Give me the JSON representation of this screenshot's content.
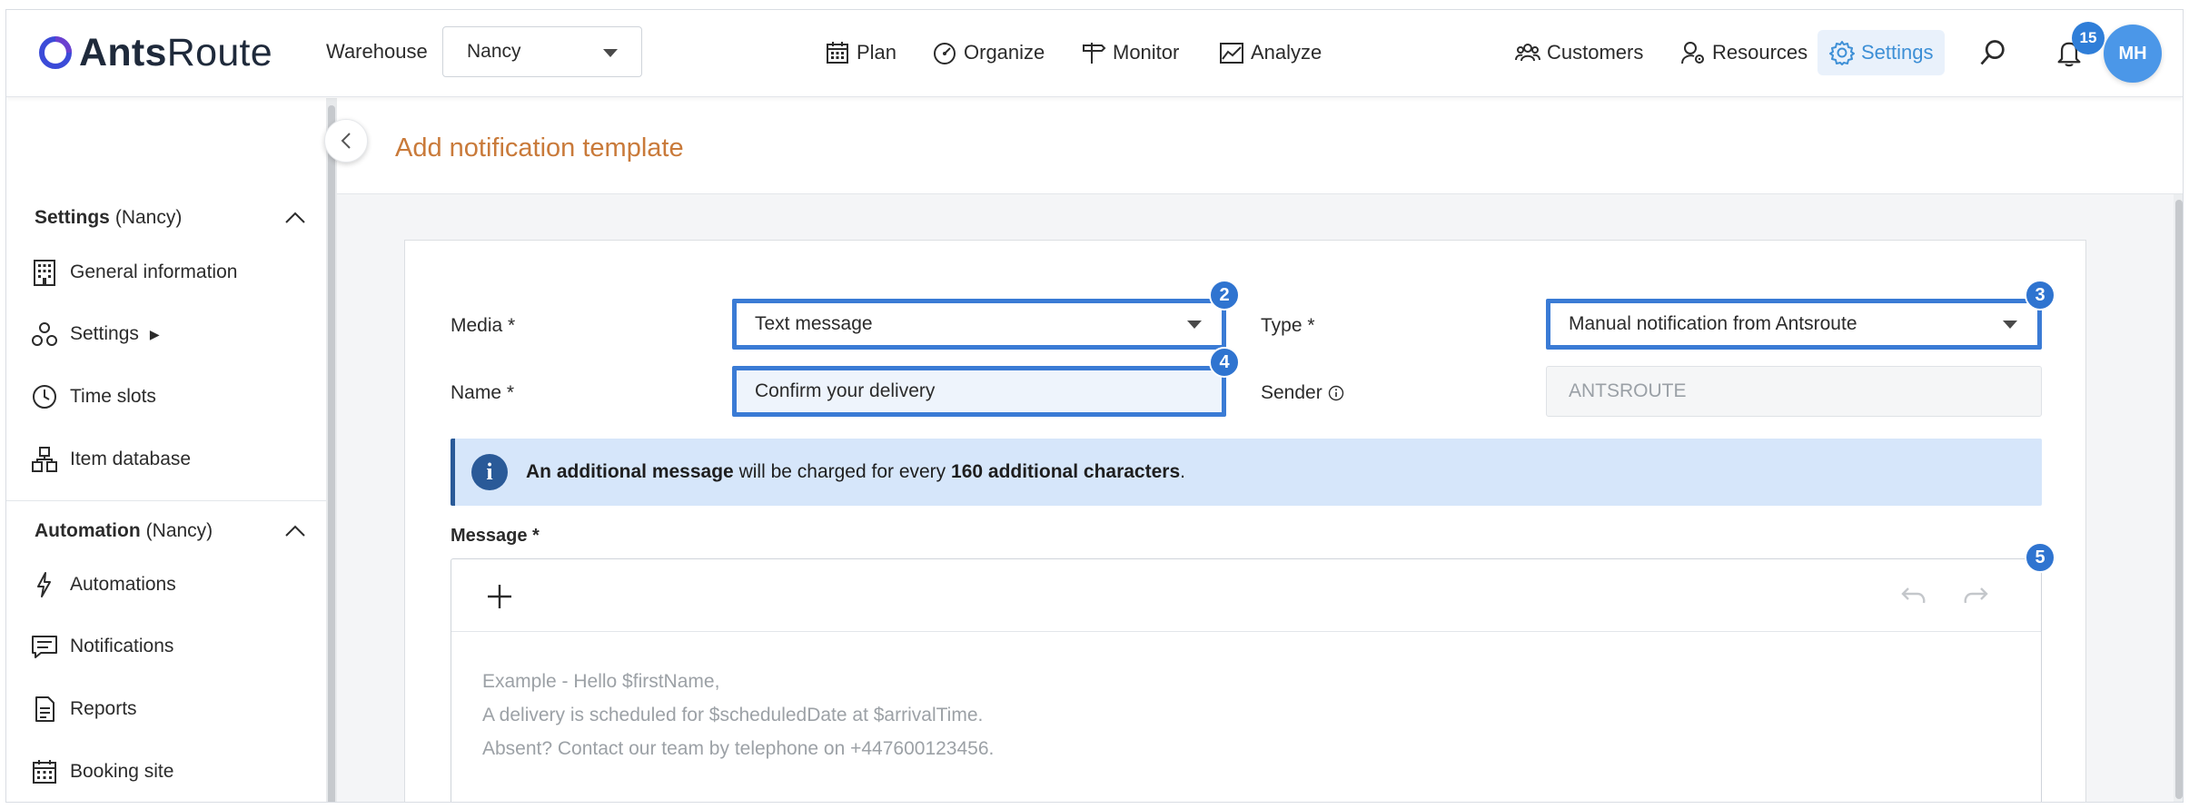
{
  "app": {
    "logo_text_bold": "Ants",
    "logo_text_light": "Route"
  },
  "header": {
    "warehouse_label": "Warehouse",
    "warehouse_value": "Nancy",
    "nav": {
      "plan": "Plan",
      "organize": "Organize",
      "monitor": "Monitor",
      "analyze": "Analyze",
      "customers": "Customers",
      "resources": "Resources",
      "settings": "Settings"
    },
    "notification_count": "15",
    "avatar_initials": "MH"
  },
  "sidebar": {
    "settings_section": {
      "title": "Settings",
      "scope": "(Nancy)"
    },
    "settings_items": [
      {
        "label": "General information",
        "icon": "building-icon"
      },
      {
        "label": "Settings",
        "icon": "cogs-icon",
        "suffix": "▶"
      },
      {
        "label": "Time slots",
        "icon": "clock-icon"
      },
      {
        "label": "Item database",
        "icon": "boxes-icon"
      }
    ],
    "automation_section": {
      "title": "Automation",
      "scope": "(Nancy)"
    },
    "automation_items": [
      {
        "label": "Automations",
        "icon": "bolt-icon"
      },
      {
        "label": "Notifications",
        "icon": "message-icon"
      },
      {
        "label": "Reports",
        "icon": "report-icon"
      },
      {
        "label": "Booking site",
        "icon": "calendar-icon"
      }
    ]
  },
  "page": {
    "title": "Add notification template"
  },
  "form": {
    "media": {
      "label": "Media *",
      "value": "Text message",
      "marker": "2"
    },
    "type": {
      "label": "Type *",
      "value": "Manual notification from Antsroute",
      "marker": "3"
    },
    "name": {
      "label": "Name *",
      "value": "Confirm your delivery",
      "marker": "4"
    },
    "sender": {
      "label": "Sender",
      "value": "ANTSROUTE"
    },
    "info": {
      "part1_bold": "An additional message",
      "part2": " will be charged for every ",
      "part3_bold": "160 additional characters",
      "part4": "."
    },
    "message": {
      "label": "Message *",
      "marker": "5",
      "placeholder_lines": [
        "Example - Hello $firstName,",
        "A delivery is scheduled for $scheduledDate at $arrivalTime.",
        "Absent? Contact our team by telephone on +447600123456."
      ]
    }
  },
  "colors": {
    "accent": "#3a7bd5",
    "title": "#c97a3a",
    "info_bg": "#d6e6fa",
    "info_accent": "#2a5a98",
    "avatar": "#4b97e8"
  }
}
